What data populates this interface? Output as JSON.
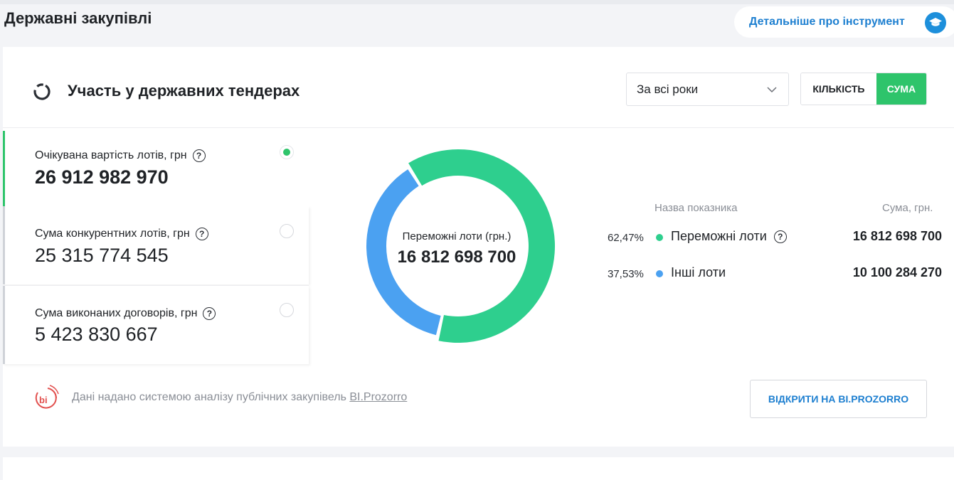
{
  "page": {
    "title": "Державні закупівлі"
  },
  "learn_more": {
    "label": "Детальніше про інструмент",
    "icon": "graduation-cap-icon",
    "color": "#1d8fdb"
  },
  "section": {
    "title": "Участь у державних тендерах",
    "icon": "donut-chart-icon"
  },
  "period_select": {
    "value": "За всі роки"
  },
  "mode_toggle": {
    "count_label": "КІЛЬКІСТЬ",
    "sum_label": "СУМА",
    "selected": "СУМА"
  },
  "metrics": [
    {
      "label": "Очікувана вартість лотів, грн",
      "value": "26 912 982 970",
      "selected": true
    },
    {
      "label": "Сума конкурентних лотів, грн",
      "value": "25 315 774 545",
      "selected": false
    },
    {
      "label": "Сума виконаних договорів, грн",
      "value": "5 423 830 667",
      "selected": false
    }
  ],
  "legend": {
    "header_name": "Назва показника",
    "header_sum": "Сума, грн.",
    "rows": [
      {
        "percent": "62,47%",
        "name": "Переможні лоти",
        "value": "16 812 698 700",
        "color": "#2ecf8e",
        "help": true
      },
      {
        "percent": "37,53%",
        "name": "Інші лоти",
        "value": "10 100 284 270",
        "color": "#4ba1f1",
        "help": false
      }
    ]
  },
  "chart_data": {
    "type": "pie",
    "categories": [
      "Переможні лоти",
      "Інші лоти"
    ],
    "values": [
      16812698700,
      10100284270
    ],
    "percentages": [
      62.47,
      37.53
    ],
    "colors": [
      "#2ecf8e",
      "#4ba1f1"
    ],
    "center_label": "Переможні лоти (грн.)",
    "center_value": "16 812 698 700"
  },
  "footer": {
    "text": "Дані надано системою аналізу публічних закупівель ",
    "link": "BI.Prozorro",
    "button": "ВІДКРИТИ НА BI.PROZORRO",
    "logo": "bi-prozorro-logo"
  },
  "colors": {
    "accent_green": "#2ec46b",
    "link_blue": "#1d7fd0"
  }
}
